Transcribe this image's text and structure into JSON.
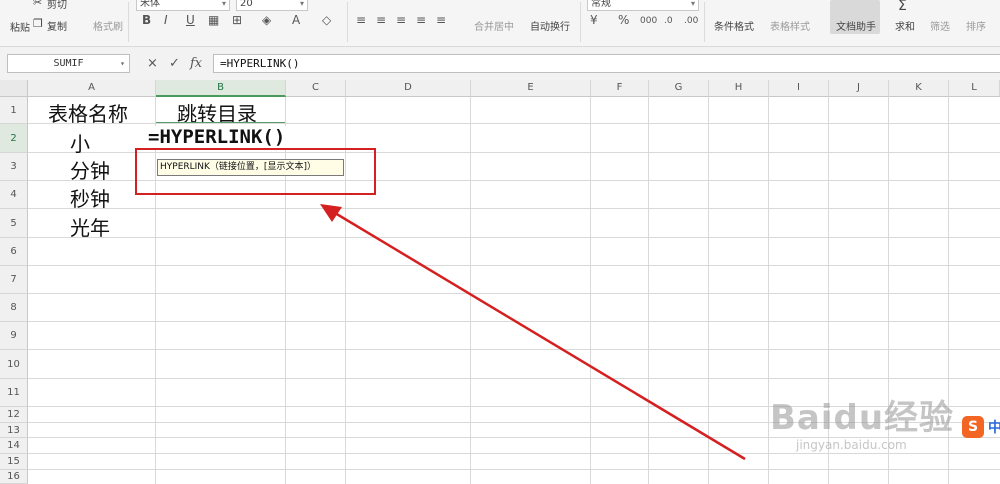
{
  "ribbon": {
    "paste": "粘贴",
    "cut": "剪切",
    "copy": "复制",
    "format_painter": "格式刷",
    "font_name": "宋体",
    "font_size": "20",
    "bold": "B",
    "italic": "I",
    "underline": "U",
    "merge_center": "合并居中",
    "wrap_text": "自动换行",
    "number_format": "常规",
    "percent": "%",
    "conditional_format": "条件格式",
    "table_style": "表格样式",
    "doc_assistant": "文档助手",
    "sum": "求和",
    "filter": "筛选",
    "sort": "排序"
  },
  "formula_bar": {
    "name_box": "SUMIF",
    "cancel": "×",
    "confirm": "✓",
    "fx": "fx",
    "formula": "=HYPERLINK()"
  },
  "columns": [
    "A",
    "B",
    "C",
    "D",
    "E",
    "F",
    "G",
    "H",
    "I",
    "J",
    "K",
    "L"
  ],
  "rows": [
    "1",
    "2",
    "3",
    "4",
    "5",
    "6",
    "7",
    "8",
    "9",
    "10",
    "11",
    "12",
    "13",
    "14",
    "15",
    "16"
  ],
  "cells": {
    "A1": "表格名称",
    "B1": "跳转目录",
    "A2": "小",
    "A3": "分钟",
    "A4": "秒钟",
    "A5": "光年",
    "B2": "=HYPERLINK()"
  },
  "tooltip": "HYPERLINK（链接位置，[显示文本]）",
  "watermark": {
    "brand": "Baidu经验",
    "url": "jingyan.baidu.com"
  },
  "ime": {
    "logo": "S",
    "mode": "中"
  },
  "colors": {
    "annotation": "#d42020",
    "selection": "#217346"
  }
}
